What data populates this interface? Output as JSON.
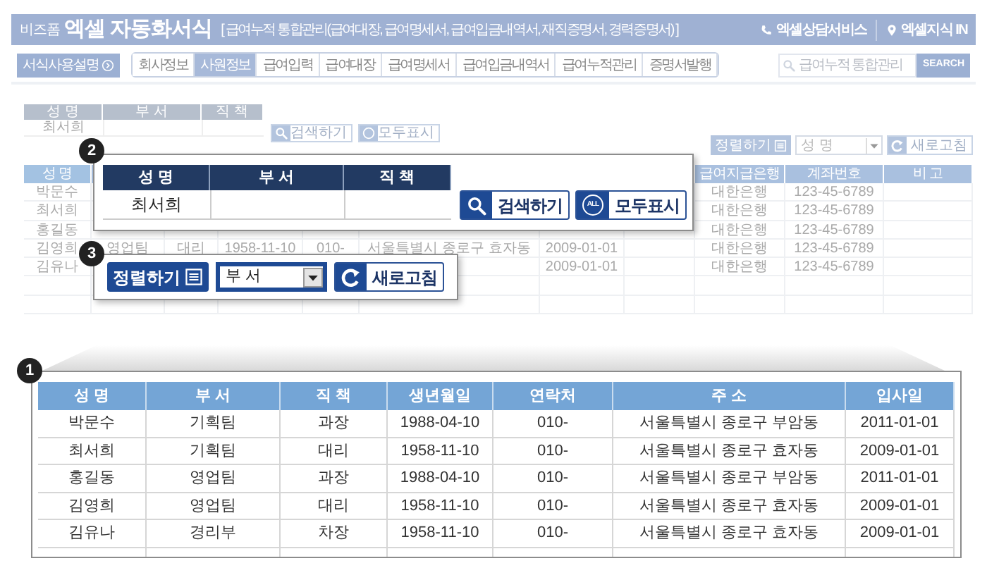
{
  "header": {
    "brand": "비즈폼",
    "title": "엑셀 자동화서식",
    "subtitle": "[ 급여누적 통합관리(급여대장, 급여명세서, 급여입금내역서, 재직증명서, 경력증명서) ]",
    "links": [
      {
        "kind": "phone",
        "label": "엑셀상담서비스"
      },
      {
        "kind": "pin",
        "label": "엑셀지식 IN"
      }
    ]
  },
  "toolbar": {
    "help_button": "서식사용설명",
    "tabs": [
      {
        "label": "회사정보",
        "selected": false
      },
      {
        "label": "사원정보",
        "selected": true
      },
      {
        "label": "급여입력",
        "selected": false
      },
      {
        "label": "급여대장",
        "selected": false
      },
      {
        "label": "급여명세서",
        "selected": false
      },
      {
        "label": "급여입금내역서",
        "selected": false
      },
      {
        "label": "급여누적관리",
        "selected": false
      },
      {
        "label": "증명서발행",
        "selected": false
      }
    ],
    "search": {
      "placeholder": "급여누적 통합관리",
      "button": "SEARCH"
    }
  },
  "search_panel": {
    "columns": [
      "성 명",
      "부 서",
      "직 책"
    ],
    "name_value": "최서희",
    "buttons": [
      {
        "kind": "search",
        "label": "검색하기"
      },
      {
        "kind": "all",
        "label": "모두표시"
      }
    ]
  },
  "sort_bar": {
    "label": "정렬하기",
    "value": "성 명",
    "refresh": "새로고침"
  },
  "employee_table": {
    "columns": {
      "name": "성 명",
      "bank": "급여지급은행",
      "account": "계좌번호",
      "note": "비 고"
    },
    "rows": [
      {
        "name": "박문수",
        "bank": "대한은행",
        "account": "123-45-6789"
      },
      {
        "name": "최서희",
        "bank": "대한은행",
        "account": "123-45-6789"
      },
      {
        "name": "홍길동",
        "bank": "대한은행",
        "account": "123-45-6789"
      },
      {
        "name": "김영희",
        "dept": "영업팀",
        "position": "대리",
        "birth": "1958-11-10",
        "phone": "010-",
        "address": "서울특별시 종로구 효자동",
        "joined": "2009-01-01",
        "bank": "대한은행",
        "account": "123-45-6789"
      },
      {
        "name": "김유나",
        "joined": "2009-01-01",
        "bank": "대한은행",
        "account": "123-45-6789"
      }
    ]
  },
  "callout_2": {
    "badge": "2",
    "columns": [
      "성 명",
      "부 서",
      "직 책"
    ],
    "name_value": "최서희",
    "buttons": [
      {
        "kind": "search",
        "label": "검색하기"
      },
      {
        "kind": "all",
        "label": "모두표시",
        "icon_text": "ALL"
      }
    ]
  },
  "callout_3": {
    "badge": "3",
    "label": "정렬하기",
    "value": "부 서",
    "refresh": "새로고침"
  },
  "callout_1": {
    "badge": "1",
    "columns": [
      "성 명",
      "부 서",
      "직 책",
      "생년월일",
      "연락처",
      "주 소",
      "입사일"
    ],
    "rows": [
      [
        "박문수",
        "기획팀",
        "과장",
        "1988-04-10",
        "010-",
        "서울특별시 종로구 부암동",
        "2011-01-01"
      ],
      [
        "최서희",
        "기획팀",
        "대리",
        "1958-11-10",
        "010-",
        "서울특별시 종로구 효자동",
        "2009-01-01"
      ],
      [
        "홍길동",
        "영업팀",
        "과장",
        "1988-04-10",
        "010-",
        "서울특별시 종로구 부암동",
        "2011-01-01"
      ],
      [
        "김영희",
        "영업팀",
        "대리",
        "1958-11-10",
        "010-",
        "서울특별시 종로구 효자동",
        "2009-01-01"
      ],
      [
        "김유나",
        "경리부",
        "차장",
        "1958-11-10",
        "010-",
        "서울특별시 종로구 효자동",
        "2009-01-01"
      ]
    ]
  }
}
